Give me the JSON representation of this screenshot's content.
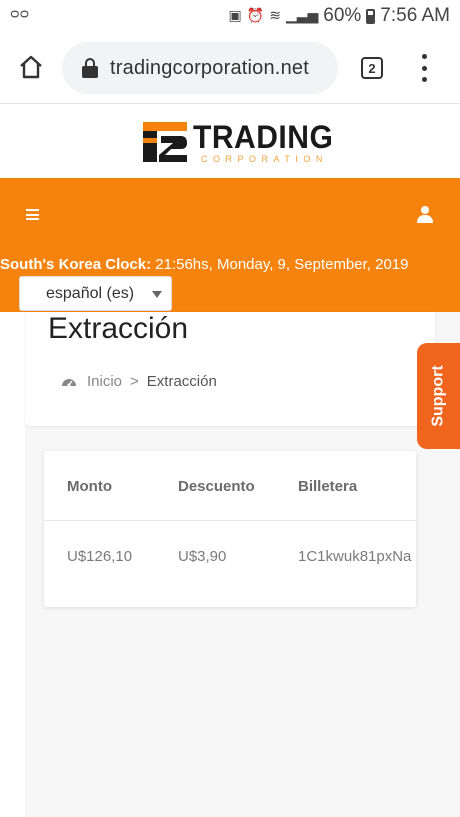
{
  "status_bar": {
    "left_icon": "voicemail-icon",
    "battery": "60%",
    "time": "7:56 AM",
    "icons": [
      "image-icon",
      "alarm-icon",
      "wifi-icon",
      "signal-icon",
      "battery-icon"
    ]
  },
  "browser": {
    "url": "tradingcorporation.net",
    "tab_count": "2"
  },
  "logo": {
    "word": "TRADING",
    "sub": "CORPORATION"
  },
  "header": {
    "clock_label": "South's Korea Clock:",
    "clock_value": " 21:56hs, Monday, 9, September, 2019",
    "language": "español (es)"
  },
  "page": {
    "title": "Extracción",
    "breadcrumb": {
      "home": "Inicio",
      "separator": ">",
      "current": "Extracción"
    }
  },
  "support": {
    "label": "Support"
  },
  "table": {
    "columns": [
      "Monto",
      "Descuento",
      "Billetera"
    ],
    "rows": [
      [
        "U$126,10",
        "U$3,90",
        "1C1kwuk81pxNa"
      ]
    ]
  },
  "colors": {
    "accent": "#f7830f",
    "support": "#f0641e",
    "logo_sub": "#f4a13c"
  }
}
